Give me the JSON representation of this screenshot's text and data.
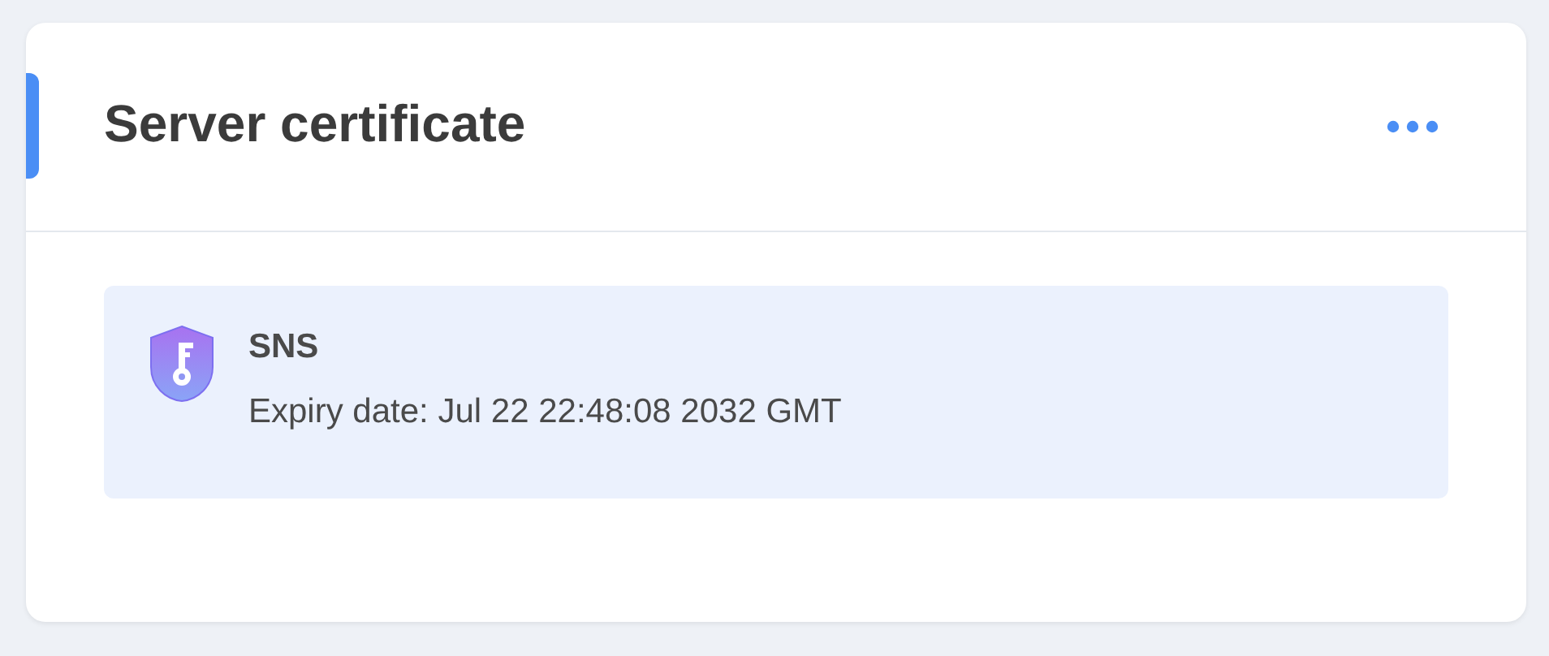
{
  "card": {
    "title": "Server certificate"
  },
  "certificates": [
    {
      "name": "SNS",
      "expiry": "Expiry date: Jul 22 22:48:08 2032 GMT"
    }
  ]
}
